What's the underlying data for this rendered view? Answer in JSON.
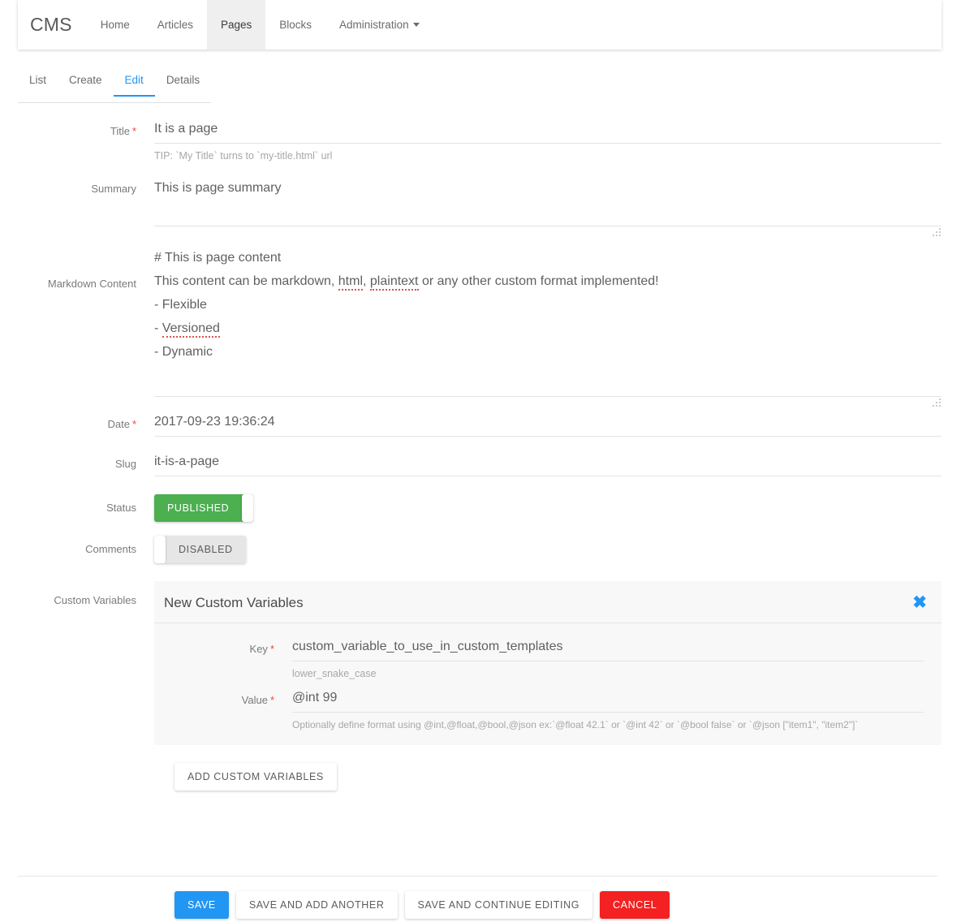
{
  "navbar": {
    "brand": "CMS",
    "items": [
      {
        "label": "Home",
        "active": false,
        "dropdown": false
      },
      {
        "label": "Articles",
        "active": false,
        "dropdown": false
      },
      {
        "label": "Pages",
        "active": true,
        "dropdown": false
      },
      {
        "label": "Blocks",
        "active": false,
        "dropdown": false
      },
      {
        "label": "Administration",
        "active": false,
        "dropdown": true
      }
    ]
  },
  "tabs": [
    {
      "label": "List",
      "active": false
    },
    {
      "label": "Create",
      "active": false
    },
    {
      "label": "Edit",
      "active": true
    },
    {
      "label": "Details",
      "active": false
    }
  ],
  "form": {
    "title": {
      "label": "Title",
      "required": true,
      "value": "It is a page",
      "help": "TIP: `My Title` turns to `my-title.html` url"
    },
    "summary": {
      "label": "Summary",
      "required": false,
      "value": "This is page summary"
    },
    "markdown": {
      "label": "Markdown Content",
      "required": false,
      "lines": [
        {
          "text": "# This is page content"
        },
        {
          "pre": "This content can be markdown, ",
          "misspelled": [
            "html",
            "plaintext"
          ],
          "sep": ", ",
          "post": " or any other custom format implemented!"
        },
        {
          "text": "- Flexible"
        },
        {
          "pre": "- ",
          "misspelled": [
            "Versioned"
          ],
          "post": ""
        },
        {
          "text": "- Dynamic"
        }
      ]
    },
    "date": {
      "label": "Date",
      "required": true,
      "value": "2017-09-23 19:36:24"
    },
    "slug": {
      "label": "Slug",
      "required": false,
      "value": "it-is-a-page"
    },
    "status": {
      "label": "Status",
      "toggle_text": "PUBLISHED",
      "state": "on"
    },
    "comments": {
      "label": "Comments",
      "toggle_text": "DISABLED",
      "state": "off"
    },
    "custom_variables": {
      "label": "Custom Variables",
      "panel_title": "New Custom Variables",
      "close_icon": "✖",
      "key": {
        "label": "Key",
        "required": true,
        "value": "custom_variable_to_use_in_custom_templates",
        "help": "lower_snake_case"
      },
      "value": {
        "label": "Value",
        "required": true,
        "value": "@int 99",
        "help": "Optionally define format using @int,@float,@bool,@json ex:`@float 42.1` or `@int 42` or `@bool false` or `@json [\"item1\", \"item2\"]`"
      },
      "add_button": "ADD CUSTOM VARIABLES"
    }
  },
  "actions": {
    "save": "SAVE",
    "save_add_another": "SAVE AND ADD ANOTHER",
    "save_continue": "SAVE AND CONTINUE EDITING",
    "cancel": "CANCEL"
  },
  "colors": {
    "accent": "#2196f3",
    "success": "#4caf50",
    "danger": "#f32121",
    "required": "#f44336"
  }
}
